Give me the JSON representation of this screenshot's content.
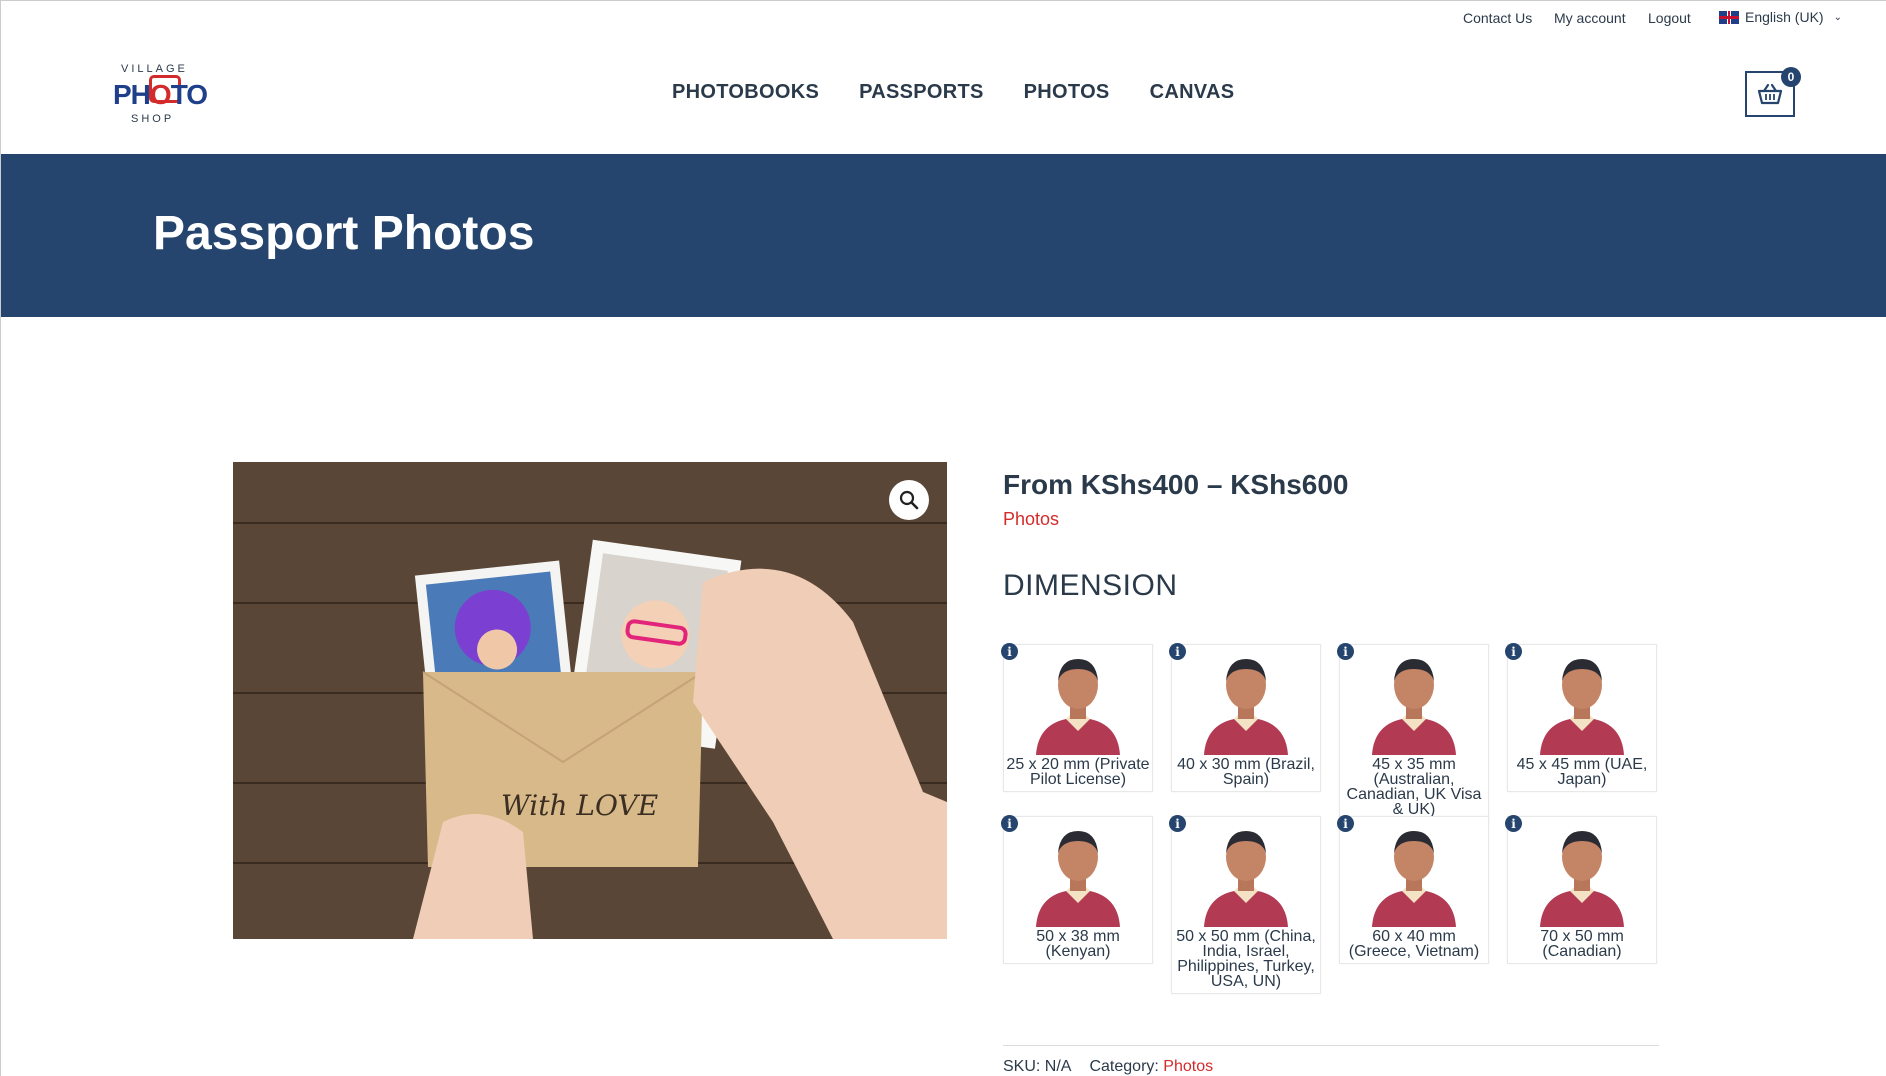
{
  "topbar": {
    "contact": "Contact Us",
    "account": "My account",
    "logout": "Logout",
    "language": "English (UK)"
  },
  "logo": {
    "line1": "VILLAGE",
    "line2_a": "PH",
    "line2_b": "O",
    "line2_c": "TO",
    "line3": "SHOP"
  },
  "nav": {
    "items": [
      "PHOTOBOOKS",
      "PASSPORTS",
      "PHOTOS",
      "CANVAS"
    ]
  },
  "cart": {
    "count": "0"
  },
  "banner": {
    "title": "Passport Photos"
  },
  "product": {
    "price": "From KShs400 – KShs600",
    "category_link": "Photos",
    "attribute_label": "DIMENSION",
    "image_text": "With LOVE",
    "dimensions": [
      "25 x 20 mm (Private Pilot License)",
      "40 x 30 mm (Brazil, Spain)",
      "45 x 35 mm (Australian, Canadian, UK Visa & UK)",
      "45 x 45 mm (UAE, Japan)",
      "50 x 38 mm (Kenyan)",
      "50 x 50 mm (China, India, Israel, Philippines, Turkey, USA, UN)",
      "60 x 40 mm (Greece, Vietnam)",
      "70 x 50 mm (Canadian)"
    ],
    "sku_label": "SKU:",
    "sku_value": "N/A",
    "category_label": "Category:",
    "category_value": "Photos"
  },
  "colors": {
    "navy": "#26456e",
    "accent_red": "#d32b2b",
    "text": "#2b3a4a"
  },
  "icons": {
    "cart": "basket-icon",
    "zoom": "magnifier-icon",
    "info": "info-icon",
    "flag": "uk-flag-icon"
  }
}
